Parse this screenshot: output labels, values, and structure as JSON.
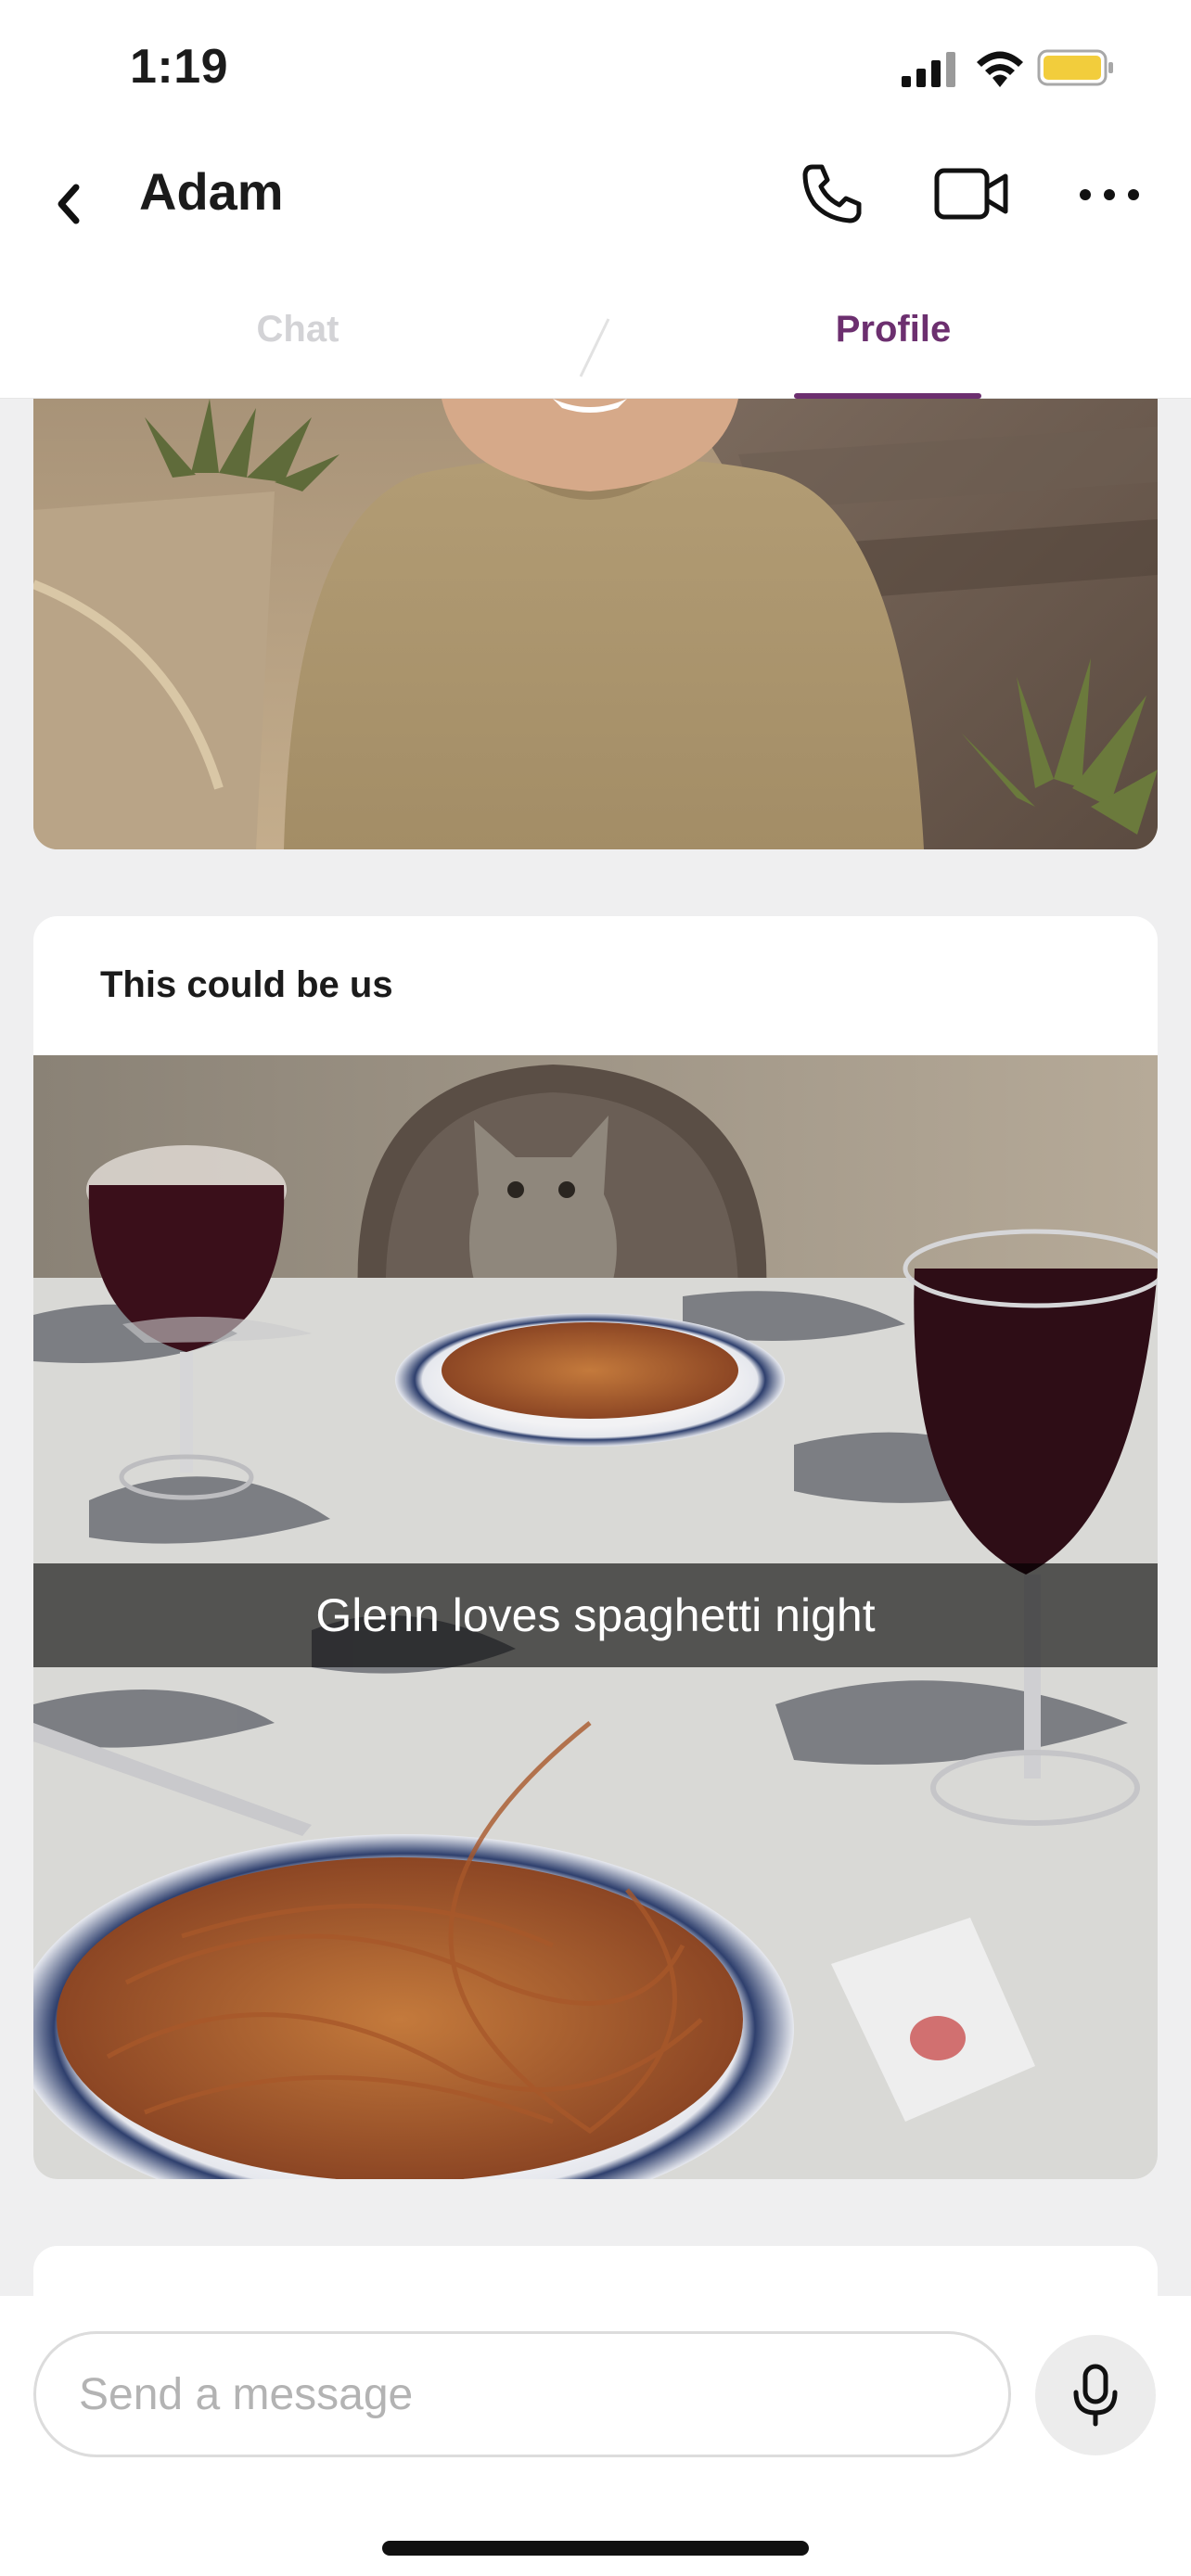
{
  "status_bar": {
    "time": "1:19"
  },
  "header": {
    "contact_name": "Adam",
    "icons": {
      "back": "chevron-left-icon",
      "phone": "phone-icon",
      "video": "video-camera-icon",
      "more": "more-horizontal-icon"
    }
  },
  "tabs": [
    {
      "label": "Chat",
      "active": false
    },
    {
      "label": "Profile",
      "active": true
    }
  ],
  "colors": {
    "accent": "#6c2f6f",
    "inactive_tab": "#d3d3d6",
    "background": "#efeff0"
  },
  "profile": {
    "prompt_card": {
      "title": "This could be us",
      "photo_caption": "Glenn loves spaghetti night"
    }
  },
  "composer": {
    "placeholder": "Send a message",
    "mic_icon": "microphone-icon"
  }
}
